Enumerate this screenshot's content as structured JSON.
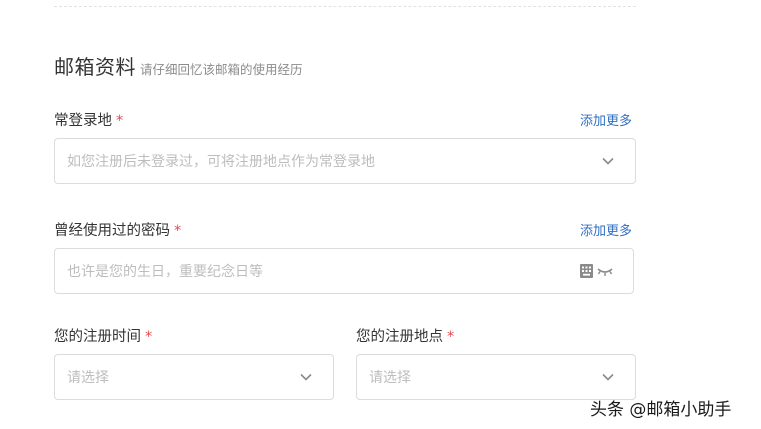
{
  "section": {
    "title": "邮箱资料",
    "subtitle": "请仔细回忆该邮箱的使用经历"
  },
  "login_place": {
    "label": "常登录地",
    "required_mark": "*",
    "add_more": "添加更多",
    "placeholder": "如您注册后未登录过，可将注册地点作为常登录地",
    "icon": "chevron-down-icon"
  },
  "password": {
    "label": "曾经使用过的密码",
    "required_mark": "*",
    "add_more": "添加更多",
    "placeholder": "也许是您的生日，重要纪念日等",
    "icons": [
      "keyboard-icon",
      "eye-closed-icon"
    ]
  },
  "register_time": {
    "label": "您的注册时间",
    "required_mark": "*",
    "placeholder": "请选择",
    "icon": "chevron-down-icon"
  },
  "register_place": {
    "label": "您的注册地点",
    "required_mark": "*",
    "placeholder": "请选择",
    "icon": "chevron-down-icon"
  },
  "watermark": "头条 @邮箱小助手",
  "colors": {
    "required": "#e5484d",
    "link": "#2f6fc4",
    "border": "#dcdcdc",
    "placeholder": "#bdbdbd"
  }
}
